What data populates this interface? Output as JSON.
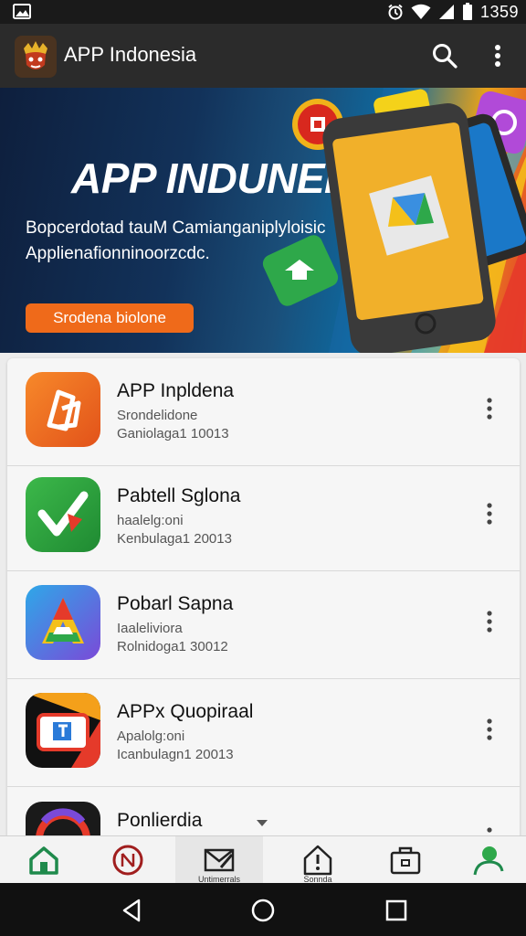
{
  "status_bar": {
    "time": "1359",
    "icons": [
      "image-icon",
      "alarm-icon",
      "wifi-icon",
      "signal-icon",
      "battery-icon"
    ]
  },
  "app_bar": {
    "title": "APP Indonesia",
    "icons": [
      "app-logo",
      "search-icon",
      "more-vert-icon"
    ]
  },
  "banner": {
    "headline": "APP INDUNEIA",
    "subtitle_line1": "Bopcerdotad tauM Camianganiplyloisic",
    "subtitle_line2": "Applienafionninoorzcdc.",
    "cta_label": "Srodena biolone"
  },
  "apps": [
    {
      "name": "APP Inpldena",
      "meta1": "Srondelidone",
      "meta2": "Ganiolaga1 10013",
      "icon": "orange-pages-icon",
      "color": "#f0701e"
    },
    {
      "name": "Pabtell Sglona",
      "meta1": "haalelg:oni",
      "meta2": "Kenbulaga1 20013",
      "icon": "green-check-icon",
      "color": "#2e9c3a"
    },
    {
      "name": "Pobarl Sapna",
      "meta1": "Iaaleliviora",
      "meta2": "Rolnidoga1 30012",
      "icon": "triangle-a-icon",
      "color": "#2a8ae0"
    },
    {
      "name": "APPx Quopiraal",
      "meta1": "Apalolg:oni",
      "meta2": "Icanbulagn1 20013",
      "icon": "tv-screen-icon",
      "color": "#1a1a1a"
    },
    {
      "name": "Ponlierdia",
      "meta1": "",
      "meta2": "",
      "icon": "circle-ring-icon",
      "color": "#e53a2a"
    }
  ],
  "bottom_nav": [
    {
      "label": "",
      "icon": "home-icon"
    },
    {
      "label": "",
      "icon": "no-entry-icon"
    },
    {
      "label": "Untimerrals",
      "icon": "mail-edit-icon"
    },
    {
      "label": "Sonnda",
      "icon": "house-alert-icon"
    },
    {
      "label": "",
      "icon": "briefcase-icon"
    },
    {
      "label": "",
      "icon": "person-icon"
    }
  ],
  "system_nav": {
    "icons": [
      "back-icon",
      "home-circle-icon",
      "recents-icon"
    ]
  },
  "colors": {
    "app_bar": "#2b2b2b",
    "status_bar": "#1a1a1a",
    "cta": "#ef6a1a",
    "nav_active": "#1f8a4c"
  }
}
